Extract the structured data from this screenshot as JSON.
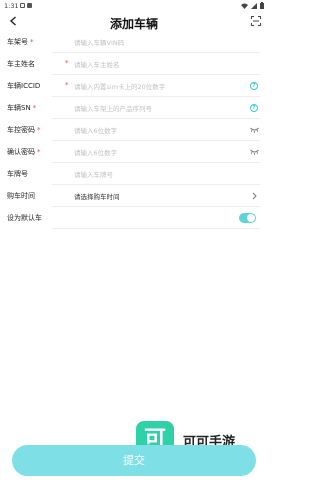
{
  "status_bar": {
    "time": "1:31"
  },
  "header": {
    "title": "添加车辆"
  },
  "form": {
    "rows": [
      {
        "label": "车架号",
        "placeholder": "请输入车辆VIN码"
      },
      {
        "label": "车主姓名",
        "placeholder": "请输入车主姓名"
      },
      {
        "label": "车辆ICCID",
        "placeholder": "请输入内置sim卡上的20位数字"
      },
      {
        "label": "车辆SN",
        "placeholder": "请输入车架上的产品序列号"
      },
      {
        "label": "车控密码",
        "placeholder": "请输入6位数字"
      },
      {
        "label": "确认密码",
        "placeholder": "请输入6位数字"
      },
      {
        "label": "车牌号",
        "placeholder": "请输入车牌号"
      },
      {
        "label": "购车时间",
        "placeholder": "请选择购车时间"
      },
      {
        "label": "设为默认车"
      }
    ],
    "required_mark": "*",
    "default_car_enabled": true
  },
  "watermark": {
    "logo_char": "可",
    "text": "可可手游"
  },
  "submit": {
    "label": "提交"
  },
  "colors": {
    "accent": "#5fd2db",
    "required": "#e5484d",
    "submit_bg": "#7fdfe6",
    "logo_bg": "#2fd1a6"
  }
}
